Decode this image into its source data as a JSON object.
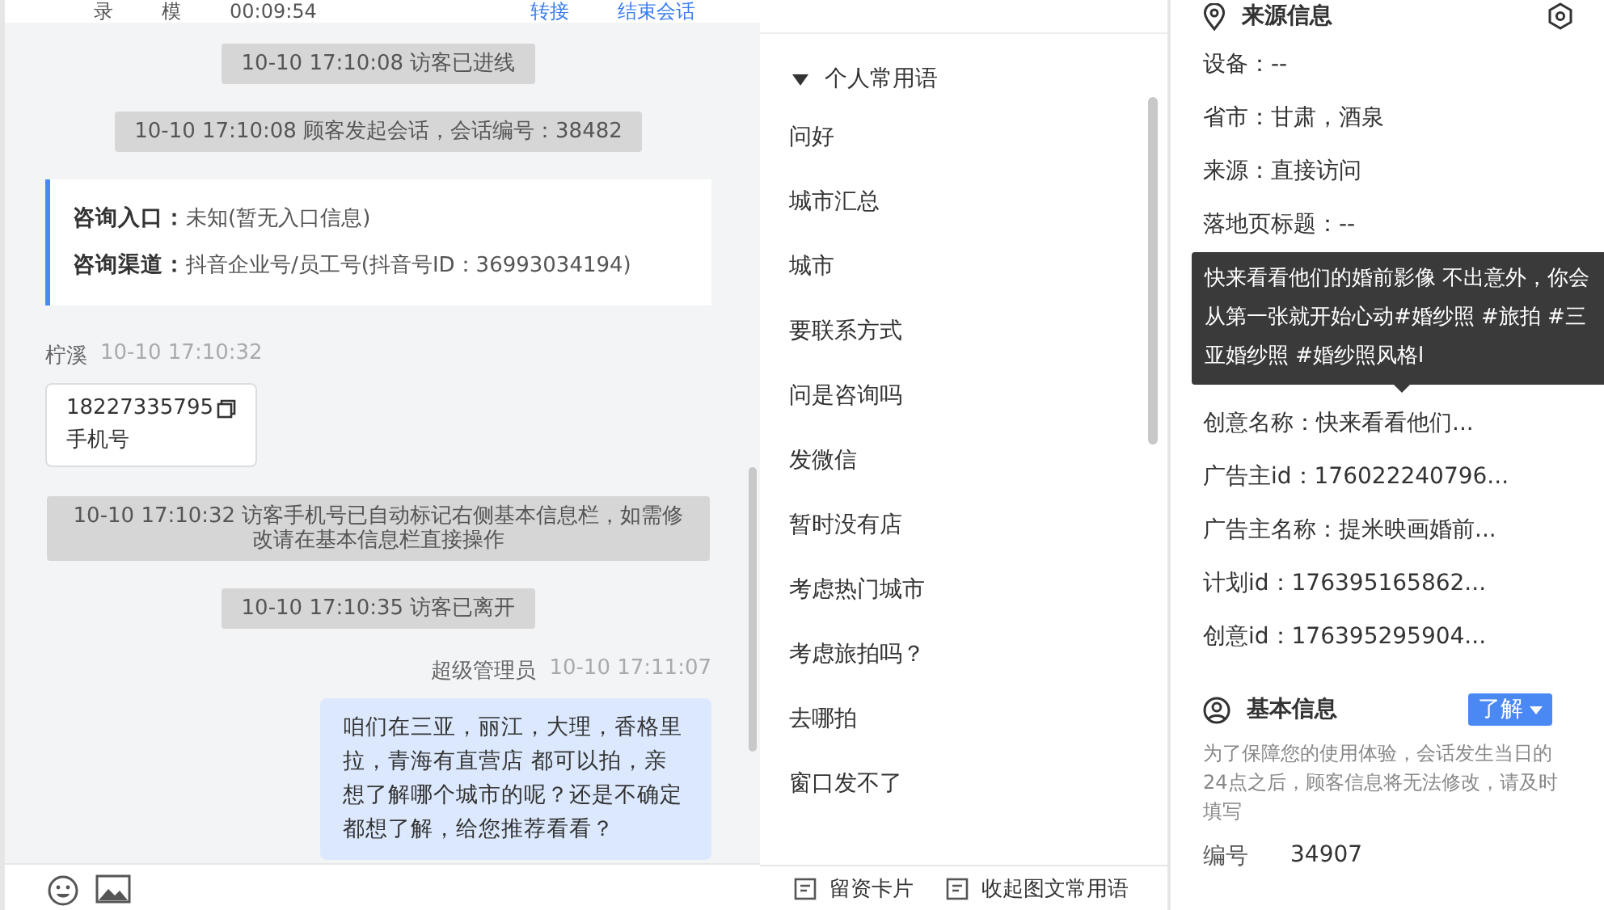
{
  "header": {
    "cells": [
      "录",
      "模",
      "00:09:54"
    ],
    "actions": [
      "转接",
      "结束会话"
    ]
  },
  "messages": [
    {
      "kind": "system",
      "text": "10-10 17:10:08 访客已进线"
    },
    {
      "kind": "system",
      "text": "10-10 17:10:08 顾客发起会话，会话编号：38482"
    },
    {
      "kind": "entry",
      "rows": [
        {
          "label": "咨询入口：",
          "value": "未知(暂无入口信息)"
        },
        {
          "label": "咨询渠道：",
          "value": "抖音企业号/员工号(抖音号ID：36993034194)"
        }
      ]
    },
    {
      "kind": "visitor",
      "sender": "柠溪",
      "time": "10-10 17:10:32",
      "phone": "18227335795",
      "phone_label": "手机号"
    },
    {
      "kind": "system",
      "text": "10-10 17:10:32 访客手机号已自动标记右侧基本信息栏，如需修改请在基本信息栏直接操作"
    },
    {
      "kind": "system",
      "text": "10-10 17:10:35 访客已离开"
    },
    {
      "kind": "agent",
      "sender": "超级管理员",
      "time": "10-10 17:11:07",
      "text": "咱们在三亚，丽江，大理，香格里拉，青海有直营店 都可以拍，亲想了解哪个城市的呢？还是不确定都想了解，给您推荐看看？"
    }
  ],
  "phrases": {
    "group": "个人常用语",
    "expanded": true,
    "items": [
      "问好",
      "城市汇总",
      "城市",
      "要联系方式",
      "问是咨询吗",
      "发微信",
      "暂时没有店",
      "考虑热门城市",
      "考虑旅拍吗？",
      "去哪拍",
      "窗口发不了"
    ]
  },
  "bottom_actions": [
    "留资卡片",
    "收起图文常用语"
  ],
  "source_info": {
    "title": "来源信息",
    "items_before": [
      "设备：--",
      "省市：甘肃，酒泉",
      "来源：直接访问",
      "落地页标题：--"
    ],
    "tooltip": "快来看看他们的婚前影像 不出意外，你会从第一张就开始心动#婚纱照 #旅拍 #三亚婚纱照 #婚纱照风格l",
    "items_after": [
      "创意名称：快来看看他们...",
      "广告主id：176022240796...",
      "广告主名称：提米映画婚前...",
      "计划id：176395165862...",
      "创意id：176395295904..."
    ]
  },
  "basic_info": {
    "title": "基本信息",
    "button": "了解",
    "notice": "为了保障您的使用体验，会话发生当日的24点之后，顾客信息将无法修改，请及时填写",
    "fields": [
      {
        "label": "编号",
        "value": "34907"
      }
    ]
  }
}
